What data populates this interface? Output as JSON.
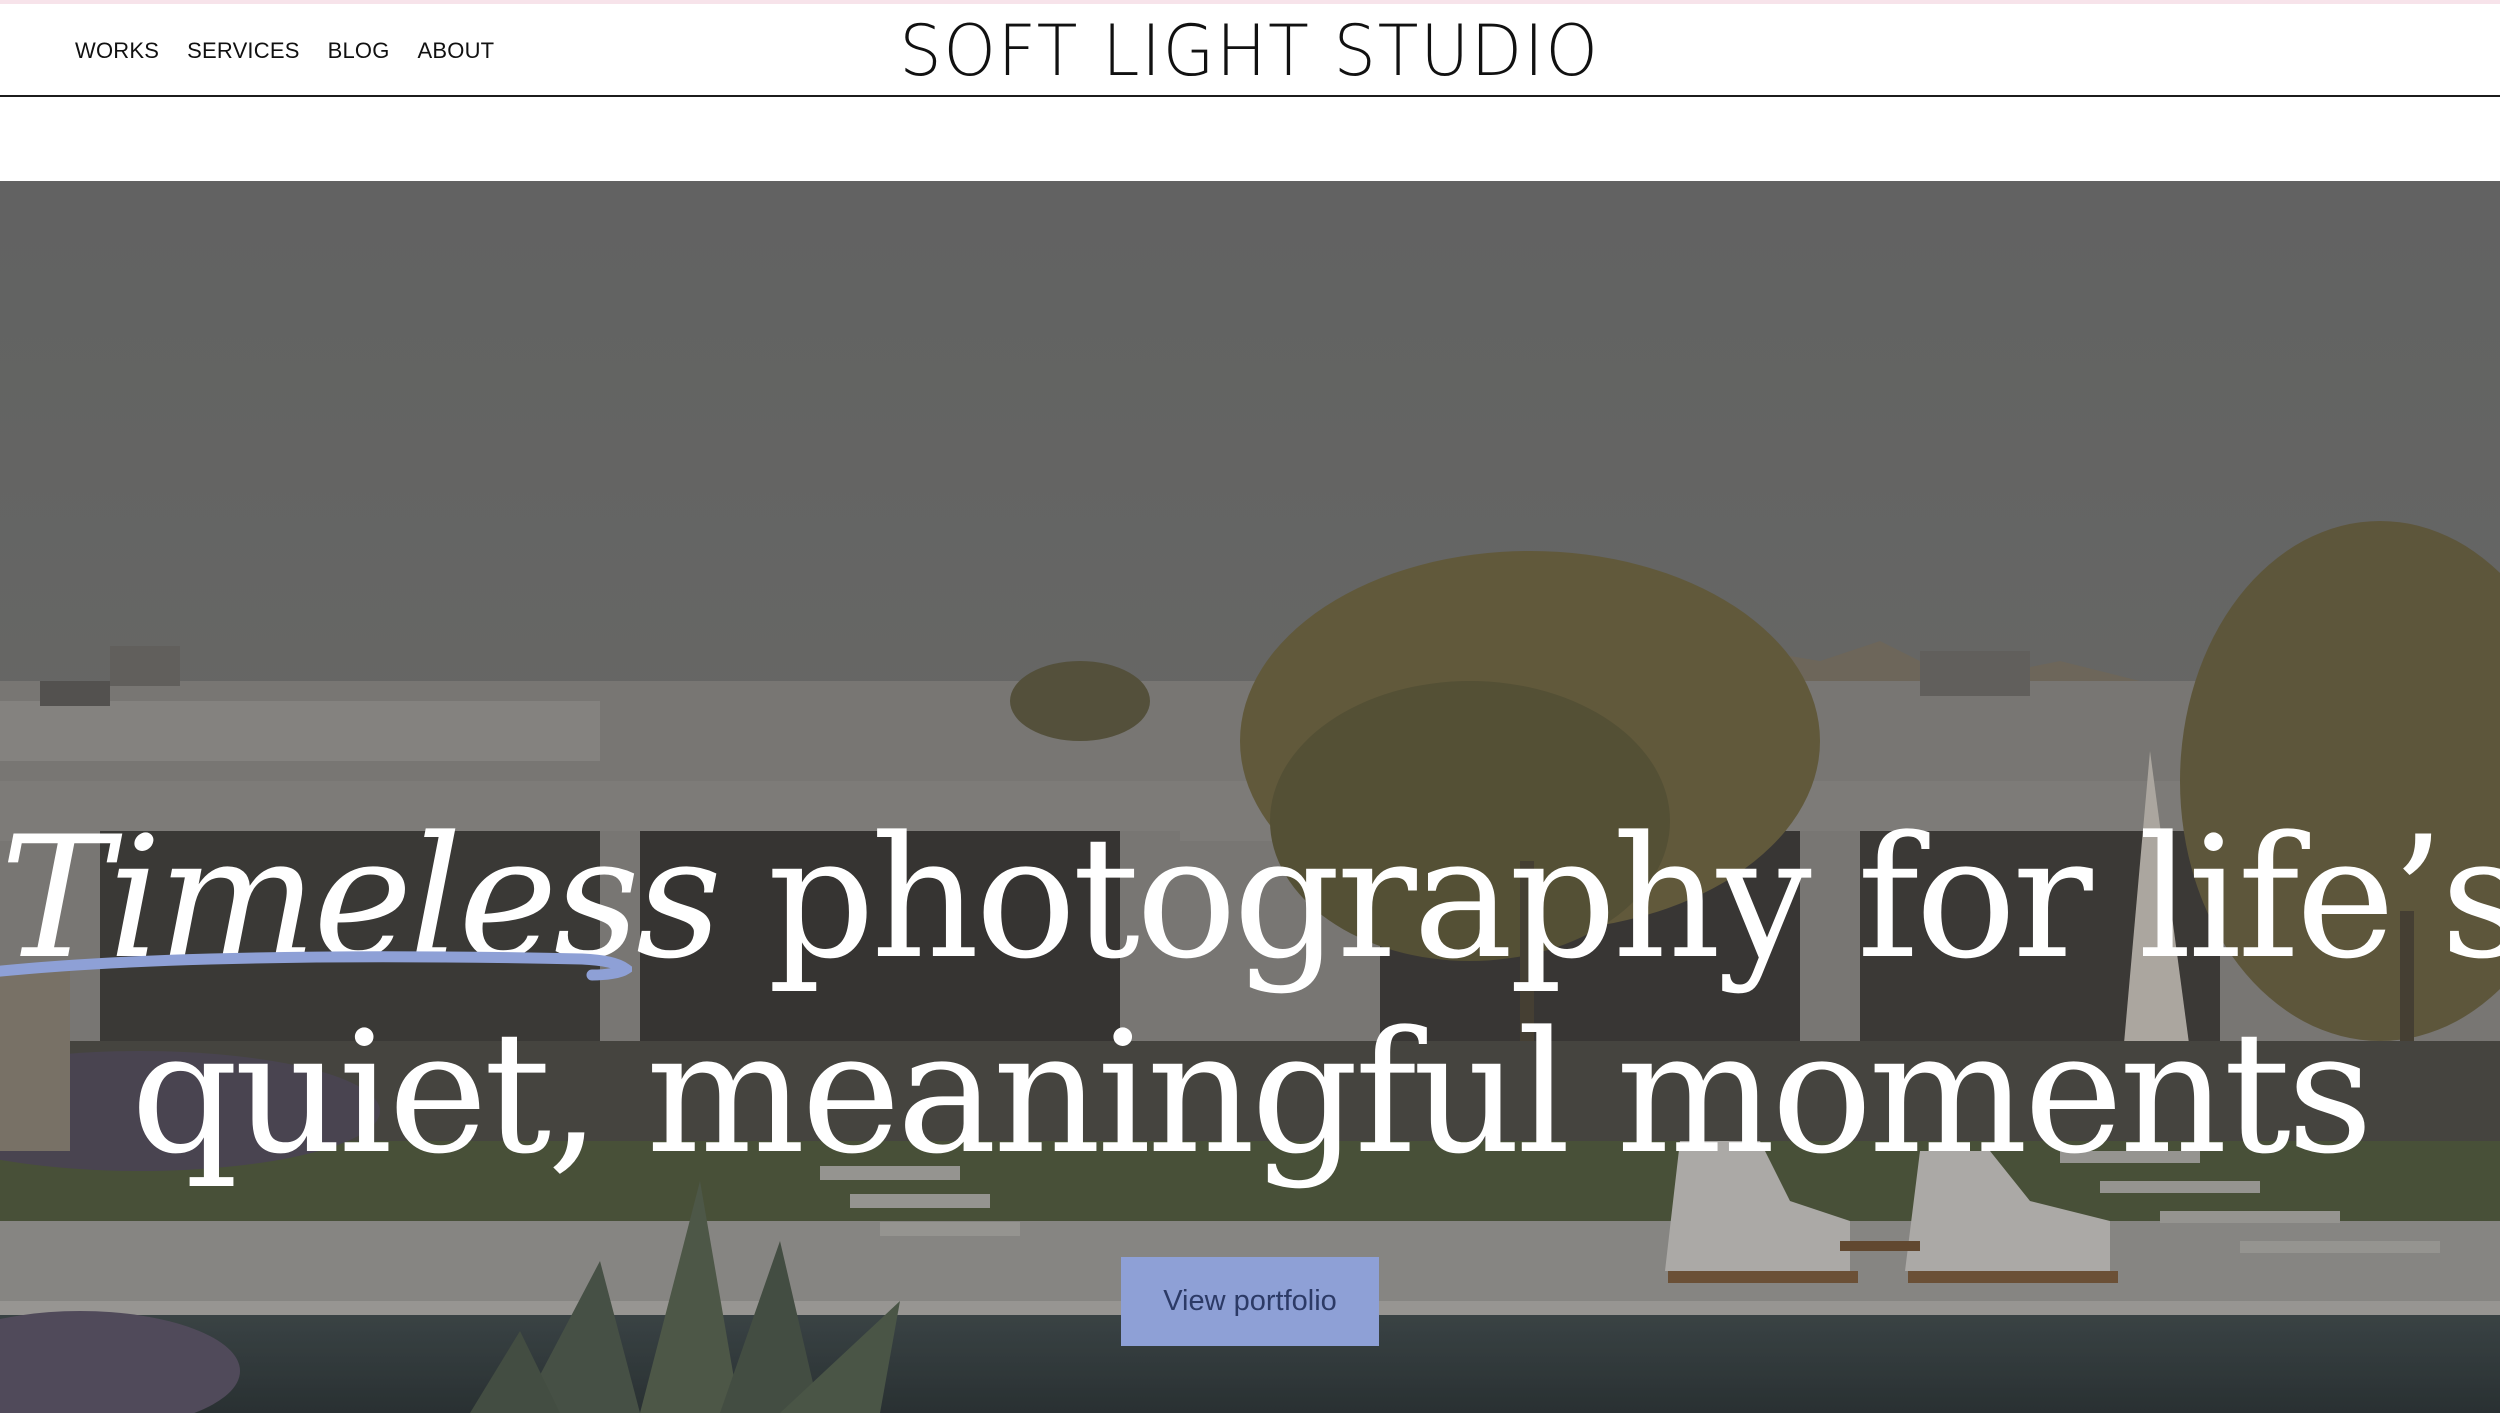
{
  "brand": {
    "name": "SOFT LIGHT STUDIO"
  },
  "nav": {
    "items": [
      {
        "label": "WORKS"
      },
      {
        "label": "SERVICES"
      },
      {
        "label": "BLOG"
      },
      {
        "label": "ABOUT"
      }
    ]
  },
  "hero": {
    "title_emphasis": "Timeless",
    "title_rest_line1": "photography for life’s",
    "title_line2": "quiet, meaningful moments",
    "cta_label": "View portfolio",
    "image_alt": "Modern white house with pool, garden and lounge chairs at dusk"
  },
  "colors": {
    "accent": "#8ea0d6",
    "accent_text": "#2c3a66",
    "header_border": "#1c1c1c",
    "top_accent": "#f7e3ea"
  }
}
